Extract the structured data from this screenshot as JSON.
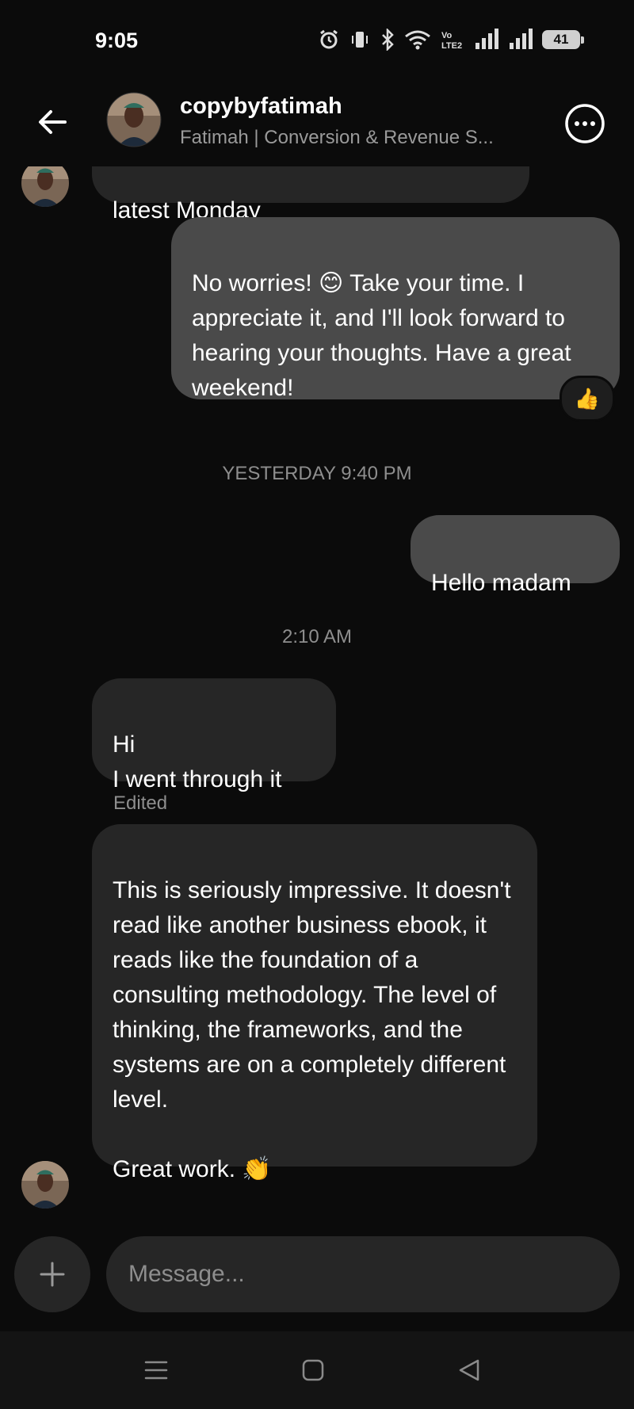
{
  "status_bar": {
    "time": "9:05",
    "battery": "41"
  },
  "header": {
    "title": "copybyfatimah",
    "subtitle": "Fatimah | Conversion & Revenue S..."
  },
  "messages": {
    "partial_incoming": "latest Monday",
    "outgoing_1": "No worries!  😊 Take your time. I appreciate it, and I'll look forward to hearing your thoughts. Have a great weekend!",
    "reaction": "👍",
    "timestamp_1": "YESTERDAY 9:40 PM",
    "outgoing_2": "Hello madam",
    "timestamp_2": "2:10 AM",
    "incoming_1": "Hi\nI went through it",
    "edited_label": "Edited",
    "incoming_2": "This is seriously impressive. It doesn't read like another business ebook, it reads like the foundation of a consulting methodology. The level of thinking, the frameworks, and the systems are on a completely different level.\n\nGreat work. 👏"
  },
  "composer": {
    "placeholder": "Message..."
  },
  "icons": {
    "back": "arrow-left-icon",
    "more": "more-options-icon",
    "add": "plus-icon",
    "nav_menu": "menu-icon",
    "nav_home": "home-icon",
    "nav_back": "back-triangle-icon"
  },
  "colors": {
    "background": "#0b0b0b",
    "incoming_bubble": "#262626",
    "outgoing_bubble": "#4a4a4a",
    "secondary_text": "#8e8e8e"
  }
}
